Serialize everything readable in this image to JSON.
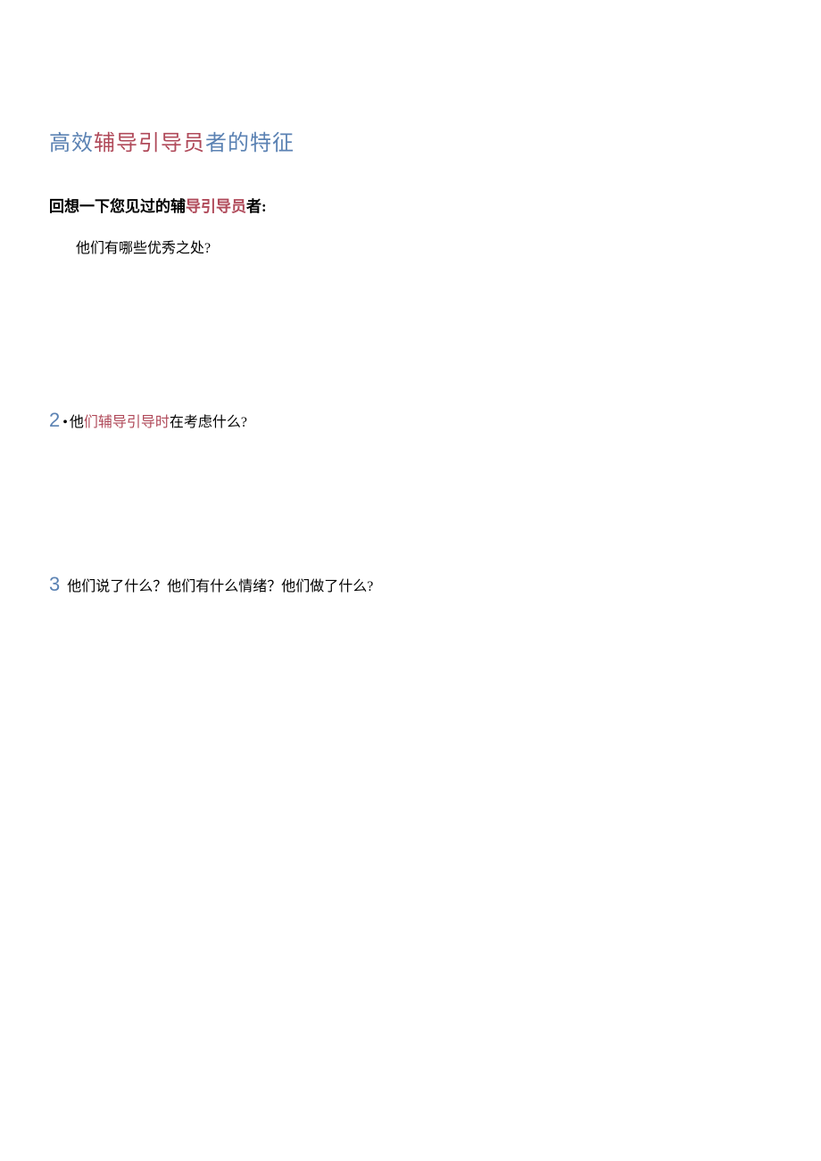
{
  "title": {
    "seg1": "高效",
    "seg2": "辅导引导员",
    "seg3": "者",
    "seg4": "的特征"
  },
  "subtitle": {
    "seg1": "回想一下您见过的辅",
    "seg2": "导引导员",
    "seg3": "者",
    "seg4": ":"
  },
  "q1": "他们有哪些优秀之处?",
  "q2": {
    "num": "2",
    "bullet": "•",
    "seg1": "他",
    "seg2": "们辅导引导时",
    "seg3": "在考虑什么?"
  },
  "q3": {
    "num": "3",
    "text": "他们说了什么？他们有什么情绪？他们做了什么?"
  }
}
